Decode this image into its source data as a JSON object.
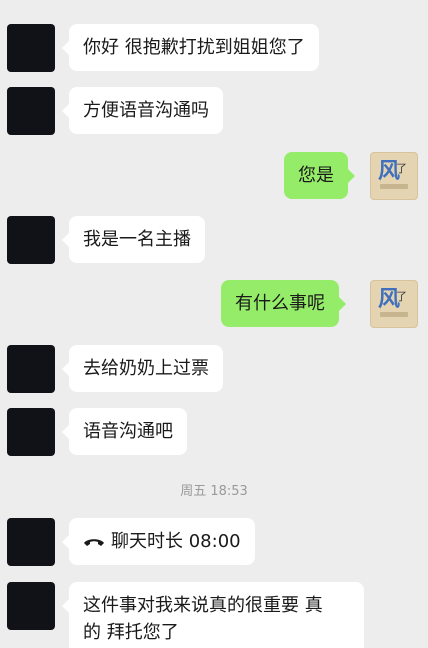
{
  "messages": [
    {
      "side": "left",
      "text": "你好 很抱歉打扰到姐姐您了"
    },
    {
      "side": "left",
      "text": "方便语音沟通吗"
    },
    {
      "side": "right",
      "text": "您是"
    },
    {
      "side": "left",
      "text": "我是一名主播"
    },
    {
      "side": "right",
      "text": "有什么事呢"
    },
    {
      "side": "left",
      "text": "去给奶奶上过票"
    },
    {
      "side": "left",
      "text": "语音沟通吧"
    }
  ],
  "timestamp": "周五 18:53",
  "call": {
    "label": "聊天时长 08:00",
    "icon": "phone-hangup-icon"
  },
  "last_message": {
    "line1": "这件事对我来说真的很重要 真",
    "line2": "的 拜托您了"
  },
  "avatar_badge": {
    "mark": "风",
    "small": "了"
  }
}
